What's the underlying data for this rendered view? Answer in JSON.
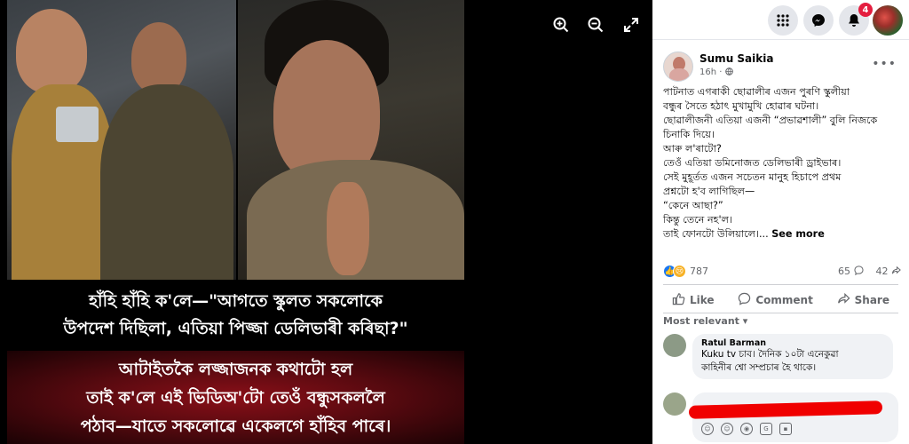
{
  "viewer": {
    "zoom_in_icon": "zoom-in-icon",
    "zoom_out_icon": "zoom-out-icon",
    "fullscreen_icon": "expand-icon",
    "caption_top": [
      "হাঁহি হাঁহি ক'লে—\"আগতে স্কুলত সকলোকে",
      "উপদেশ দিছিলা, এতিয়া পিজ্জা ডেলিভাৰী কৰিছা?\""
    ],
    "caption_bottom": [
      "আটাইতকৈ লজ্জাজনক কথাটো হল",
      "তাই ক'লে এই ভিডিঅ'টো তেওঁ বন্ধুসকললৈ",
      "পঠাব—যাতে সকলোৱে একেলগে হাঁহিব পাৰে।"
    ]
  },
  "topbar": {
    "menu_icon": "grid-menu-icon",
    "messenger_icon": "messenger-icon",
    "notifications_icon": "bell-icon",
    "notification_count": "4"
  },
  "post": {
    "author": "Sumu Saikia",
    "time": "16h ·",
    "privacy_icon": "globe-icon",
    "more_icon": "more-options-icon",
    "lines": [
      "পাটনাত এগৰাকী ছোৱালীৰ এজন পুৰণি স্কুলীয়া",
      "বন্ধুৰ সৈতে হঠাৎ মুখামুখি হোৱাৰ ঘটনা।",
      "ছোৱালীজনী এতিয়া এজনী “প্ৰভাৱশালী” বুলি নিজকে",
      "চিনাকি দিয়ে।",
      "আৰু ল'ৰাটো?",
      "তেওঁ এতিয়া ডমিনোজত ডেলিভাৰী ড্ৰাইভাৰ।",
      "সেই মুহূৰ্তত এজন সচেতন মানুহ হিচাপে প্ৰথম",
      "প্ৰশ্নটো হ'ব লাগিছিল—",
      "“কেনে আছা?”",
      "কিন্তু তেনে নহ'ল।"
    ],
    "last_line": "তাই ফোনটো উলিয়ালে।...",
    "see_more": "See more",
    "reaction_count": "787",
    "comment_count": "65",
    "share_count": "42",
    "like_label": "Like",
    "comment_label": "Comment",
    "share_label": "Share",
    "most_relevant": "Most relevant",
    "comment": {
      "name": "Ratul Barman",
      "text_line1": "Kuku tv চাব। দৈনিক ১০টা এনেকুৱা",
      "text_line2": "কাহিনীৰ শ্বো সম্প্ৰচাৰ হৈ থাকে।"
    }
  }
}
